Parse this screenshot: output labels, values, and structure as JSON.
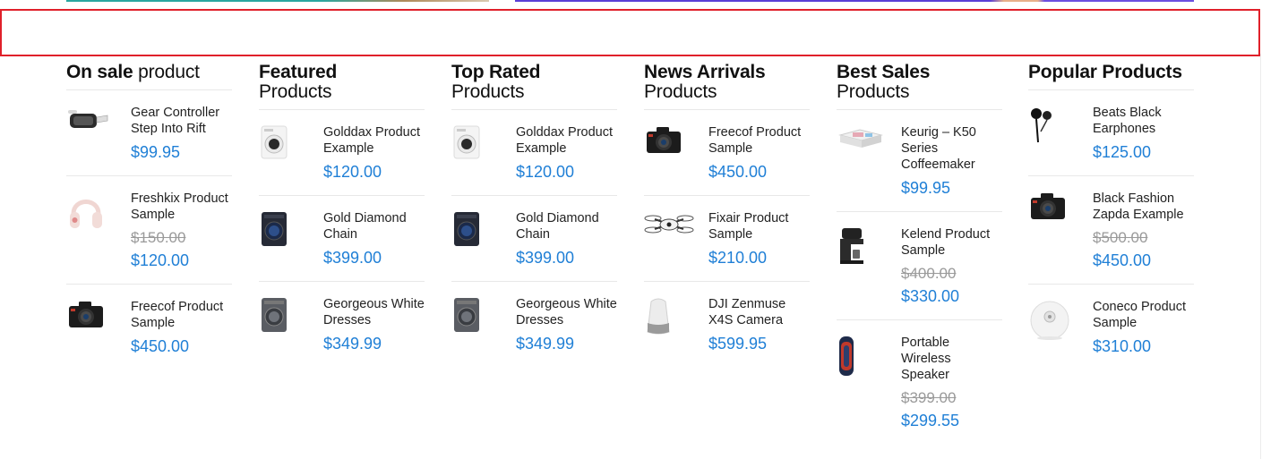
{
  "columns": [
    {
      "title_bold": "On sale",
      "title_rest": " product",
      "items": [
        {
          "name": "Gear Controller Step Into Rift",
          "price": "$99.95",
          "icon": "vr-headset-icon"
        },
        {
          "name": "Freshkix Product Sample",
          "old_price": "$150.00",
          "price": "$120.00",
          "icon": "headphones-icon"
        },
        {
          "name": "Freecof Product Sample",
          "price": "$450.00",
          "icon": "camera-icon"
        }
      ]
    },
    {
      "title_bold": "Featured",
      "title_rest": "Products",
      "items": [
        {
          "name": "Golddax Product Example",
          "price": "$120.00",
          "icon": "washer-white-icon"
        },
        {
          "name": "Gold Diamond Chain",
          "price": "$399.00",
          "icon": "washer-dark-icon"
        },
        {
          "name": "Georgeous White Dresses",
          "price": "$349.99",
          "icon": "washer-grey-icon"
        }
      ]
    },
    {
      "title_bold": "Top Rated",
      "title_rest": "Products",
      "items": [
        {
          "name": "Golddax Product Example",
          "price": "$120.00",
          "icon": "washer-white-icon"
        },
        {
          "name": "Gold Diamond Chain",
          "price": "$399.00",
          "icon": "washer-dark-icon"
        },
        {
          "name": "Georgeous White Dresses",
          "price": "$349.99",
          "icon": "washer-grey-icon"
        }
      ]
    },
    {
      "title_bold": "News Arrivals",
      "title_rest": "Products",
      "items": [
        {
          "name": "Freecof Product Sample",
          "price": "$450.00",
          "icon": "camera-icon"
        },
        {
          "name": "Fixair Product Sample",
          "price": "$210.00",
          "icon": "drone-icon"
        },
        {
          "name": "DJI Zenmuse X4S Camera",
          "price": "$599.95",
          "icon": "smart-speaker-icon"
        }
      ]
    },
    {
      "title_bold": "Best Sales",
      "title_rest": "Products",
      "items": [
        {
          "name": "Keurig – K50 Series Coffeemaker",
          "price": "$99.95",
          "icon": "printer-icon"
        },
        {
          "name": "Kelend Product Sample",
          "old_price": "$400.00",
          "price": "$330.00",
          "icon": "coffee-maker-icon"
        },
        {
          "name": "Portable Wireless Speaker",
          "old_price": "$399.00",
          "price": "$299.55",
          "icon": "portable-speaker-icon"
        }
      ]
    },
    {
      "title_bold": "Popular Products",
      "title_rest": "",
      "items": [
        {
          "name": "Beats Black Earphones",
          "price": "$125.00",
          "icon": "earphones-icon"
        },
        {
          "name": "Black Fashion Zapda Example",
          "old_price": "$500.00",
          "price": "$450.00",
          "icon": "camera-icon"
        },
        {
          "name": "Coneco Product Sample",
          "price": "$310.00",
          "icon": "round-speaker-icon"
        }
      ]
    }
  ],
  "colors": {
    "price": "#1f7fd6",
    "old_price": "#9a9a9a",
    "highlight_box": "#e0202a"
  }
}
